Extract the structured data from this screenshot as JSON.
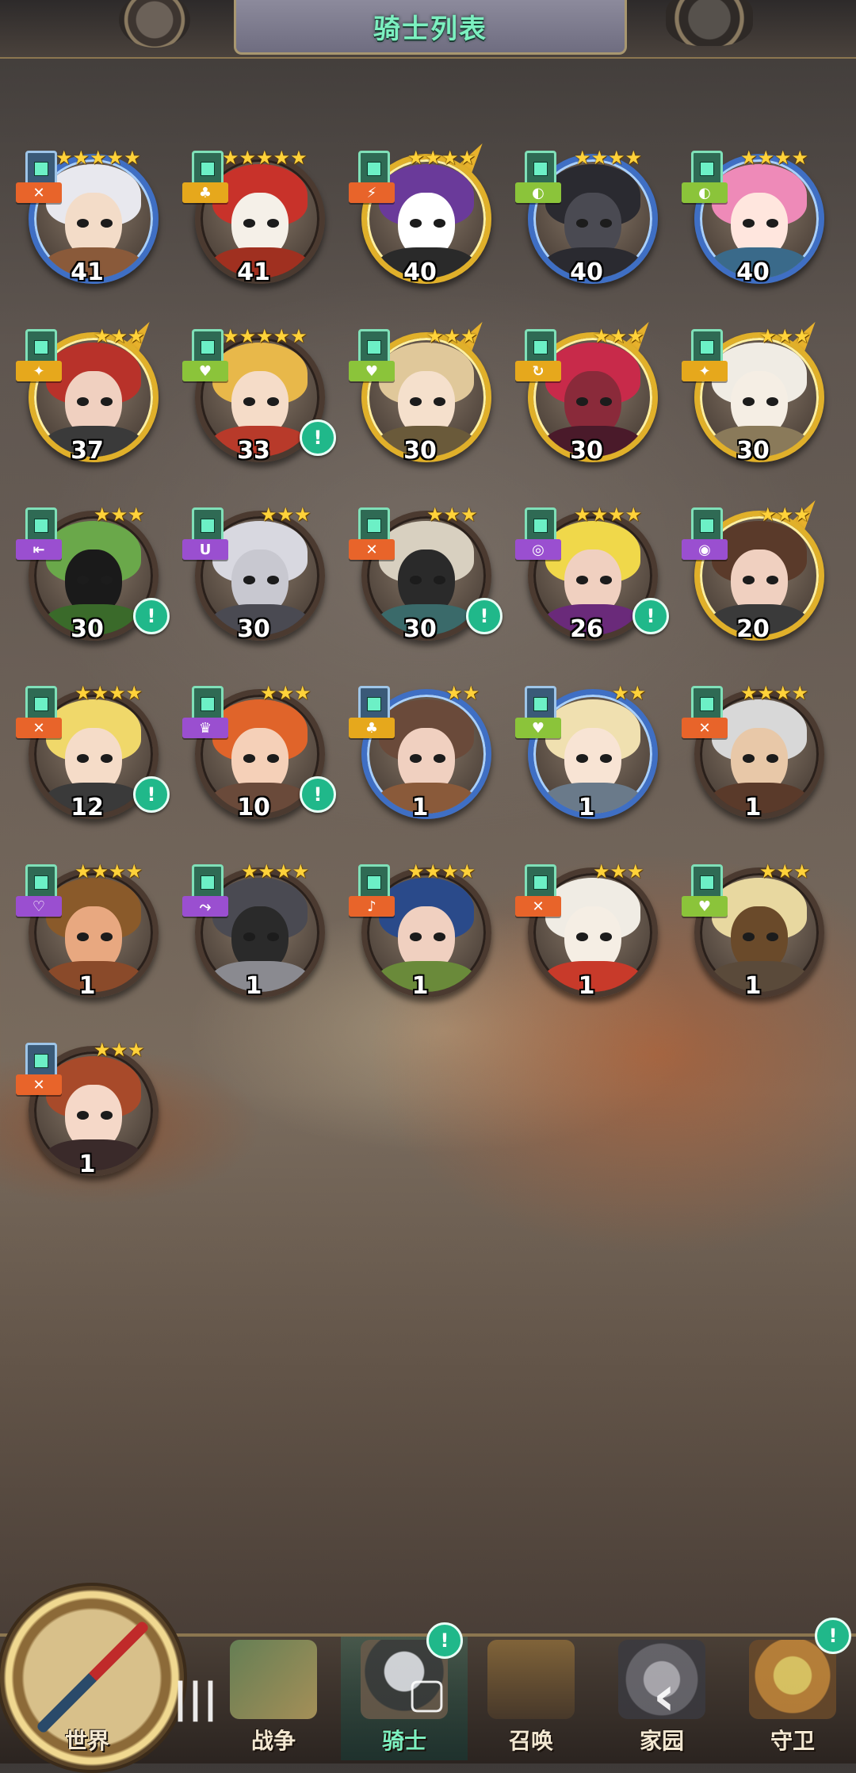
{
  "header": {
    "title": "骑士列表"
  },
  "heroes": [
    {
      "level": "41",
      "stars": 5,
      "frame": "blue",
      "shape": "blue",
      "role_color": "orange",
      "role_icon": "✕",
      "alert": false,
      "hair": "#e8e8ee",
      "skin": "#f3dcc8",
      "cloth": "#8a5a3a"
    },
    {
      "level": "41",
      "stars": 5,
      "frame": "plain",
      "shape": "green",
      "role_color": "yellow",
      "role_icon": "♣",
      "alert": false,
      "hair": "#c8322a",
      "skin": "#f5f0e8",
      "cloth": "#a03020"
    },
    {
      "level": "40",
      "stars": 4,
      "frame": "gold",
      "shape": "green",
      "role_color": "orange",
      "role_icon": "⚡",
      "alert": false,
      "hair": "#6a3a9a",
      "skin": "#ffffff",
      "cloth": "#2a2a2a"
    },
    {
      "level": "40",
      "stars": 4,
      "frame": "blue",
      "shape": "green",
      "role_color": "lime",
      "role_icon": "◐",
      "alert": false,
      "hair": "#2a2a30",
      "skin": "#4a4a52",
      "cloth": "#2a2a30"
    },
    {
      "level": "40",
      "stars": 4,
      "frame": "blue",
      "shape": "green",
      "role_color": "lime",
      "role_icon": "◐",
      "alert": false,
      "hair": "#ee8ab8",
      "skin": "#ffe6de",
      "cloth": "#3a6a8a"
    },
    {
      "level": "37",
      "stars": 3,
      "frame": "gold",
      "shape": "green",
      "role_color": "yellow",
      "role_icon": "✦",
      "alert": false,
      "hair": "#b8322a",
      "skin": "#f0d0c0",
      "cloth": "#3a3a3a"
    },
    {
      "level": "33",
      "stars": 5,
      "frame": "plain",
      "shape": "green",
      "role_color": "lime",
      "role_icon": "♥",
      "alert": true,
      "hair": "#e8b84a",
      "skin": "#f5dcc8",
      "cloth": "#b83a2a"
    },
    {
      "level": "30",
      "stars": 3,
      "frame": "gold",
      "shape": "green",
      "role_color": "lime",
      "role_icon": "♥",
      "alert": false,
      "hair": "#e0c89a",
      "skin": "#f5e0cc",
      "cloth": "#6a5a3a"
    },
    {
      "level": "30",
      "stars": 3,
      "frame": "gold",
      "shape": "green",
      "role_color": "yellow",
      "role_icon": "↻",
      "alert": false,
      "hair": "#c82a4a",
      "skin": "#8a2a3a",
      "cloth": "#4a1a2a"
    },
    {
      "level": "30",
      "stars": 3,
      "frame": "gold",
      "shape": "green",
      "role_color": "yellow",
      "role_icon": "✦",
      "alert": false,
      "hair": "#f0ece4",
      "skin": "#f5eee4",
      "cloth": "#8a7a5a"
    },
    {
      "level": "30",
      "stars": 3,
      "frame": "plain",
      "shape": "green",
      "role_color": "purple",
      "role_icon": "⇤",
      "alert": true,
      "hair": "#6aa84a",
      "skin": "#1a1a1a",
      "cloth": "#3a6a2a"
    },
    {
      "level": "30",
      "stars": 3,
      "frame": "plain",
      "shape": "green",
      "role_color": "purple",
      "role_icon": "U",
      "alert": false,
      "hair": "#d8d8e0",
      "skin": "#c8c8d0",
      "cloth": "#4a4a52"
    },
    {
      "level": "30",
      "stars": 3,
      "frame": "plain",
      "shape": "green",
      "role_color": "orange",
      "role_icon": "✕",
      "alert": true,
      "hair": "#d8d0c0",
      "skin": "#2a2a2a",
      "cloth": "#3a6a6a"
    },
    {
      "level": "26",
      "stars": 4,
      "frame": "plain",
      "shape": "green",
      "role_color": "purple",
      "role_icon": "◎",
      "alert": true,
      "hair": "#f0d84a",
      "skin": "#f0d0c0",
      "cloth": "#6a2a7a"
    },
    {
      "level": "20",
      "stars": 3,
      "frame": "gold",
      "shape": "green",
      "role_color": "purple",
      "role_icon": "◉",
      "alert": false,
      "hair": "#5a3a2a",
      "skin": "#f0d0c0",
      "cloth": "#3a3a3a"
    },
    {
      "level": "12",
      "stars": 4,
      "frame": "plain",
      "shape": "green",
      "role_color": "orange",
      "role_icon": "✕",
      "alert": true,
      "hair": "#f0d86a",
      "skin": "#f5dcc8",
      "cloth": "#3a3a3a"
    },
    {
      "level": "10",
      "stars": 3,
      "frame": "plain",
      "shape": "green",
      "role_color": "purple",
      "role_icon": "♛",
      "alert": true,
      "hair": "#e0642a",
      "skin": "#f5d0b8",
      "cloth": "#6a4a3a"
    },
    {
      "level": "1",
      "stars": 2,
      "frame": "blue",
      "shape": "blue",
      "role_color": "yellow",
      "role_icon": "♣",
      "alert": false,
      "hair": "#6a4a3a",
      "skin": "#f0d0c0",
      "cloth": "#8a5a3a"
    },
    {
      "level": "1",
      "stars": 2,
      "frame": "blue",
      "shape": "blue",
      "role_color": "lime",
      "role_icon": "♥",
      "alert": false,
      "hair": "#f0e0b0",
      "skin": "#f8e4d4",
      "cloth": "#6a7a8a"
    },
    {
      "level": "1",
      "stars": 4,
      "frame": "plain",
      "shape": "green",
      "role_color": "orange",
      "role_icon": "✕",
      "alert": false,
      "hair": "#d8d8d8",
      "skin": "#e8c8a8",
      "cloth": "#5a3a2a"
    },
    {
      "level": "1",
      "stars": 4,
      "frame": "plain",
      "shape": "green",
      "role_color": "purple",
      "role_icon": "♡",
      "alert": false,
      "hair": "#8a5a2a",
      "skin": "#e8a880",
      "cloth": "#8a4a2a"
    },
    {
      "level": "1",
      "stars": 4,
      "frame": "plain",
      "shape": "green",
      "role_color": "purple",
      "role_icon": "⤳",
      "alert": false,
      "hair": "#4a4a52",
      "skin": "#2a2a2a",
      "cloth": "#8a8a90"
    },
    {
      "level": "1",
      "stars": 4,
      "frame": "plain",
      "shape": "green",
      "role_color": "orange",
      "role_icon": "♪",
      "alert": false,
      "hair": "#2a4a8a",
      "skin": "#f0d0c0",
      "cloth": "#6a8a3a"
    },
    {
      "level": "1",
      "stars": 3,
      "frame": "plain",
      "shape": "green",
      "role_color": "orange",
      "role_icon": "✕",
      "alert": false,
      "hair": "#f0ece4",
      "skin": "#f5eee4",
      "cloth": "#c83a2a"
    },
    {
      "level": "1",
      "stars": 3,
      "frame": "plain",
      "shape": "green",
      "role_color": "lime",
      "role_icon": "♥",
      "alert": false,
      "hair": "#e8d8a0",
      "skin": "#6a4a2a",
      "cloth": "#5a4a3a"
    },
    {
      "level": "1",
      "stars": 3,
      "frame": "plain",
      "shape": "blue",
      "role_color": "orange",
      "role_icon": "✕",
      "alert": false,
      "hair": "#a84a2a",
      "skin": "#f5d8c8",
      "cloth": "#3a2a2a"
    }
  ],
  "nav": {
    "world": "世界",
    "war": "战争",
    "knight": "骑士",
    "summon": "召唤",
    "home": "家园",
    "guard": "守卫",
    "knight_alert": "!",
    "guard_alert": "!"
  },
  "system_nav": {
    "recents": "|||",
    "home": "▢",
    "back": "‹"
  }
}
